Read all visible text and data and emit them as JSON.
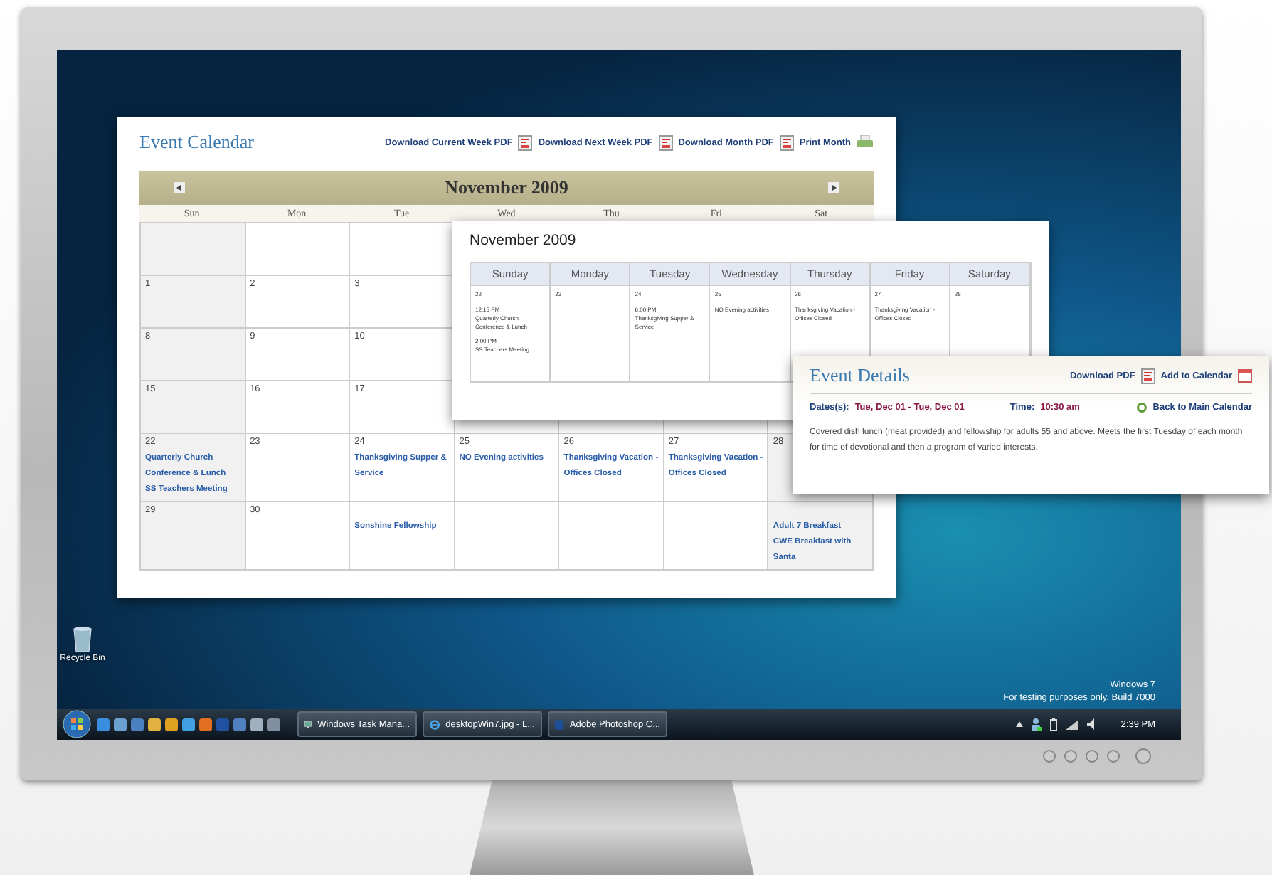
{
  "desktop": {
    "recycle_bin": "Recycle Bin",
    "watermark": [
      "Windows 7",
      "For testing purposes only. Build 7000"
    ]
  },
  "calendar_page": {
    "title": "Event Calendar",
    "links": [
      "Download Current Week PDF",
      "Download Next Week PDF",
      "Download Month PDF",
      "Print Month"
    ],
    "month": "November 2009",
    "weekdays": [
      "Sun",
      "Mon",
      "Tue",
      "Wed",
      "Thu",
      "Fri",
      "Sat"
    ],
    "weeks": [
      {
        "cells": [
          {},
          {},
          {},
          {},
          {},
          {},
          {}
        ]
      },
      {
        "cells": [
          {
            "day": "1"
          },
          {
            "day": "2"
          },
          {
            "day": "3"
          },
          {},
          {},
          {},
          {}
        ]
      },
      {
        "cells": [
          {
            "day": "8"
          },
          {
            "day": "9"
          },
          {
            "day": "10"
          },
          {},
          {},
          {},
          {}
        ]
      },
      {
        "cells": [
          {
            "day": "15"
          },
          {
            "day": "16"
          },
          {
            "day": "17"
          },
          {},
          {},
          {},
          {}
        ]
      },
      {
        "cells": [
          {
            "day": "22",
            "events": [
              "Quarterly Church Conference & Lunch",
              "SS Teachers Meeting"
            ]
          },
          {
            "day": "23"
          },
          {
            "day": "24",
            "events": [
              "Thanksgiving Supper & Service"
            ]
          },
          {
            "day": "25",
            "events": [
              "NO Evening activities"
            ]
          },
          {
            "day": "26",
            "events": [
              "Thanksgiving Vacation - Offices Closed"
            ]
          },
          {
            "day": "27",
            "events": [
              "Thanksgiving Vacation - Offices Closed"
            ]
          },
          {
            "day": "28"
          }
        ]
      },
      {
        "cells": [
          {
            "day": "29"
          },
          {
            "day": "30"
          },
          {
            "events": [
              "Sonshine Fellowship"
            ]
          },
          {},
          {},
          {},
          {
            "events": [
              "Adult 7 Breakfast",
              "CWE Breakfast with Santa"
            ]
          }
        ]
      }
    ]
  },
  "week_view": {
    "title": "November 2009",
    "days": [
      {
        "name": "Sunday",
        "date": "22",
        "events": [
          {
            "time": "12:15 PM",
            "title": "Quarterly Church Conference & Lunch"
          },
          {
            "time": "2:00 PM",
            "title": "SS Teachers Meeting"
          }
        ]
      },
      {
        "name": "Monday",
        "date": "23"
      },
      {
        "name": "Tuesday",
        "date": "24",
        "events": [
          {
            "time": "6:00 PM",
            "title": "Thanksgiving Supper & Service"
          }
        ]
      },
      {
        "name": "Wednesday",
        "date": "25",
        "events": [
          {
            "title": "NO Evening activities"
          }
        ]
      },
      {
        "name": "Thursday",
        "date": "26",
        "events": [
          {
            "title": "Thanksgiving Vacation - Offices Closed"
          }
        ]
      },
      {
        "name": "Friday",
        "date": "27",
        "events": [
          {
            "title": "Thanksgiving Vacation - Offices Closed"
          }
        ]
      },
      {
        "name": "Saturday",
        "date": "28"
      }
    ]
  },
  "event_details": {
    "title": "Event Details",
    "links": [
      "Download PDF",
      "Add to Calendar"
    ],
    "dates_label": "Dates(s):",
    "dates": "Tue, Dec 01 - Tue, Dec 01",
    "time_label": "Time:",
    "time": "10:30 am",
    "back_link": "Back to Main Calendar",
    "description": "Covered dish lunch (meat provided) and fellowship for adults 55 and above.  Meets the first Tuesday of each month for time of devotional and then a program of varied interests."
  },
  "taskbar": {
    "tasks": [
      {
        "label": "Windows Task Mana...",
        "kind": "monitor"
      },
      {
        "label": "desktopWin7.jpg - L...",
        "kind": "browser"
      },
      {
        "label": "Adobe Photoshop C...",
        "kind": "photoshop"
      }
    ],
    "clock": "2:39 PM"
  }
}
